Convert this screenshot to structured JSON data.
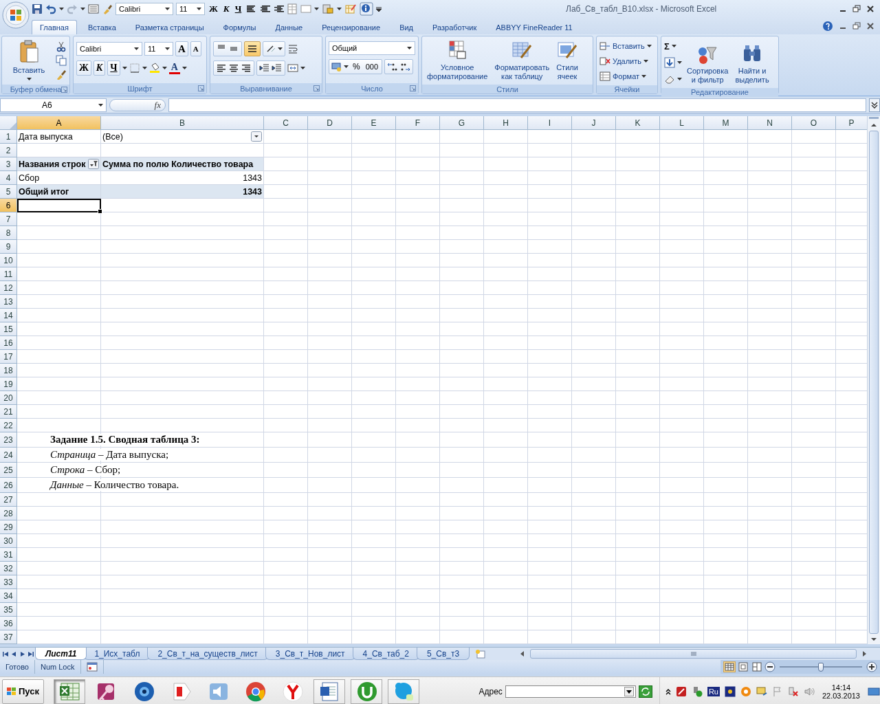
{
  "window": {
    "title": "Лаб_Св_табл_В10.xlsx - Microsoft Excel"
  },
  "quick_access": {
    "font": "Calibri",
    "size": "11",
    "bold": "Ж",
    "italic": "К",
    "underline": "Ч"
  },
  "ribbon_tabs": [
    {
      "label": "Главная",
      "selected": true
    },
    {
      "label": "Вставка",
      "selected": false
    },
    {
      "label": "Разметка страницы",
      "selected": false
    },
    {
      "label": "Формулы",
      "selected": false
    },
    {
      "label": "Данные",
      "selected": false
    },
    {
      "label": "Рецензирование",
      "selected": false
    },
    {
      "label": "Вид",
      "selected": false
    },
    {
      "label": "Разработчик",
      "selected": false
    },
    {
      "label": "ABBYY FineReader 11",
      "selected": false
    }
  ],
  "ribbon_groups": [
    {
      "kind": "clipboard",
      "title": "Буфер обмена",
      "paste": "Вставить"
    },
    {
      "kind": "font",
      "title": "Шрифт",
      "font": "Calibri",
      "size": "11",
      "grow": "A",
      "shrink": "A",
      "bold": "Ж",
      "italic": "К",
      "underline": "Ч",
      "font_color": "A"
    },
    {
      "kind": "alignment",
      "title": "Выравнивание"
    },
    {
      "kind": "number",
      "title": "Число",
      "format": "Общий",
      "percent": "%",
      "thousands": "000"
    },
    {
      "kind": "styles",
      "title": "Стили",
      "buttons": [
        {
          "lines": [
            "Условное",
            "форматирование"
          ]
        },
        {
          "lines": [
            "Форматировать",
            "как таблицу"
          ]
        },
        {
          "lines": [
            "Стили",
            "ячеек"
          ]
        }
      ]
    },
    {
      "kind": "cells",
      "title": "Ячейки",
      "buttons": [
        "Вставить",
        "Удалить",
        "Формат"
      ]
    },
    {
      "kind": "editing",
      "title": "Редактирование",
      "sum": "Σ",
      "buttons": [
        {
          "lines": [
            "Сортировка",
            "и фильтр"
          ]
        },
        {
          "lines": [
            "Найти и",
            "выделить"
          ]
        }
      ]
    }
  ],
  "formula_bar": {
    "name_box": "A6",
    "fx": "fx"
  },
  "columns": [
    {
      "label": "A",
      "selected": true
    },
    {
      "label": "B",
      "selected": false
    },
    {
      "label": "C",
      "selected": false
    },
    {
      "label": "D",
      "selected": false
    },
    {
      "label": "E",
      "selected": false
    },
    {
      "label": "F",
      "selected": false
    },
    {
      "label": "G",
      "selected": false
    },
    {
      "label": "H",
      "selected": false
    },
    {
      "label": "I",
      "selected": false
    },
    {
      "label": "J",
      "selected": false
    },
    {
      "label": "K",
      "selected": false
    },
    {
      "label": "L",
      "selected": false
    },
    {
      "label": "M",
      "selected": false
    },
    {
      "label": "N",
      "selected": false
    },
    {
      "label": "O",
      "selected": false
    },
    {
      "label": "P",
      "selected": false
    }
  ],
  "rows": [
    {
      "header": "1",
      "kind": "page",
      "selected": false,
      "cells": [
        "Дата выпуска",
        "(Все)"
      ]
    },
    {
      "header": "2",
      "kind": "empty",
      "selected": false
    },
    {
      "header": "3",
      "kind": "pivot-header",
      "selected": false,
      "cells": [
        "Названия строк",
        "Сумма по полю Количество товара"
      ]
    },
    {
      "header": "4",
      "kind": "pivot-item",
      "selected": false,
      "cells": [
        "Сбор",
        "1343"
      ]
    },
    {
      "header": "5",
      "kind": "pivot-total",
      "selected": false,
      "cells": [
        "Общий итог",
        "1343"
      ]
    },
    {
      "header": "6",
      "kind": "empty",
      "selected": true
    },
    {
      "header": "7",
      "kind": "empty",
      "selected": false
    },
    {
      "header": "8",
      "kind": "empty",
      "selected": false
    },
    {
      "header": "9",
      "kind": "empty",
      "selected": false
    },
    {
      "header": "10",
      "kind": "empty",
      "selected": false
    },
    {
      "header": "11",
      "kind": "empty",
      "selected": false
    },
    {
      "header": "12",
      "kind": "empty",
      "selected": false
    },
    {
      "header": "13",
      "kind": "empty",
      "selected": false
    },
    {
      "header": "14",
      "kind": "empty",
      "selected": false
    },
    {
      "header": "15",
      "kind": "empty",
      "selected": false
    },
    {
      "header": "16",
      "kind": "empty",
      "selected": false
    },
    {
      "header": "17",
      "kind": "empty",
      "selected": false
    },
    {
      "header": "18",
      "kind": "empty",
      "selected": false
    },
    {
      "header": "19",
      "kind": "empty",
      "selected": false
    },
    {
      "header": "20",
      "kind": "empty",
      "selected": false
    },
    {
      "header": "21",
      "kind": "empty",
      "selected": false
    },
    {
      "header": "22",
      "kind": "empty",
      "selected": false
    },
    {
      "header": "23",
      "kind": "note-title",
      "selected": false,
      "text": "Задание 1.5. Сводная таблица 3:"
    },
    {
      "header": "24",
      "kind": "note",
      "selected": false,
      "text": "*Страница* – Дата выпуска;"
    },
    {
      "header": "25",
      "kind": "note",
      "selected": false,
      "text": "*Строка* – Сбор;"
    },
    {
      "header": "26",
      "kind": "note",
      "selected": false,
      "text": "*Данные* – Количество товара."
    },
    {
      "header": "27",
      "kind": "empty",
      "selected": false
    },
    {
      "header": "28",
      "kind": "empty",
      "selected": false
    },
    {
      "header": "29",
      "kind": "empty",
      "selected": false
    },
    {
      "header": "30",
      "kind": "empty",
      "selected": false
    },
    {
      "header": "31",
      "kind": "empty",
      "selected": false
    },
    {
      "header": "32",
      "kind": "empty",
      "selected": false
    },
    {
      "header": "33",
      "kind": "empty",
      "selected": false
    },
    {
      "header": "34",
      "kind": "empty",
      "selected": false
    },
    {
      "header": "35",
      "kind": "empty",
      "selected": false
    },
    {
      "header": "36",
      "kind": "empty",
      "selected": false
    },
    {
      "header": "37",
      "kind": "empty",
      "selected": false
    }
  ],
  "sheet_tabs": [
    {
      "label": "Лист11",
      "selected": true
    },
    {
      "label": "1_Исх_табл",
      "selected": false
    },
    {
      "label": "2_Св_т_на_существ_лист",
      "selected": false
    },
    {
      "label": "3_Св_т_Нов_лист",
      "selected": false
    },
    {
      "label": "4_Св_таб_2",
      "selected": false
    },
    {
      "label": "5_Св_т3",
      "selected": false
    }
  ],
  "status_bar": {
    "state": "Готово",
    "num_lock": "Num Lock",
    "zoom": {
      "level": 0.5
    }
  },
  "taskbar": {
    "start": "Пуск",
    "apps": [
      {
        "kind": "spreadsheet",
        "running": true,
        "selected": true
      },
      {
        "kind": "key",
        "running": false,
        "selected": false
      },
      {
        "kind": "globe",
        "running": false,
        "selected": false
      },
      {
        "kind": "tag",
        "running": false,
        "selected": false
      },
      {
        "kind": "speaker",
        "running": false,
        "selected": false
      },
      {
        "kind": "browser",
        "running": false,
        "selected": false
      },
      {
        "kind": "fork",
        "running": false,
        "selected": false
      },
      {
        "kind": "document",
        "running": true,
        "selected": false
      },
      {
        "kind": "torrent",
        "running": true,
        "selected": false
      },
      {
        "kind": "chat",
        "running": true,
        "selected": false
      }
    ],
    "address_label": "Адрес",
    "language": "Ru",
    "time": "14:14",
    "date": "22.03.2013"
  }
}
